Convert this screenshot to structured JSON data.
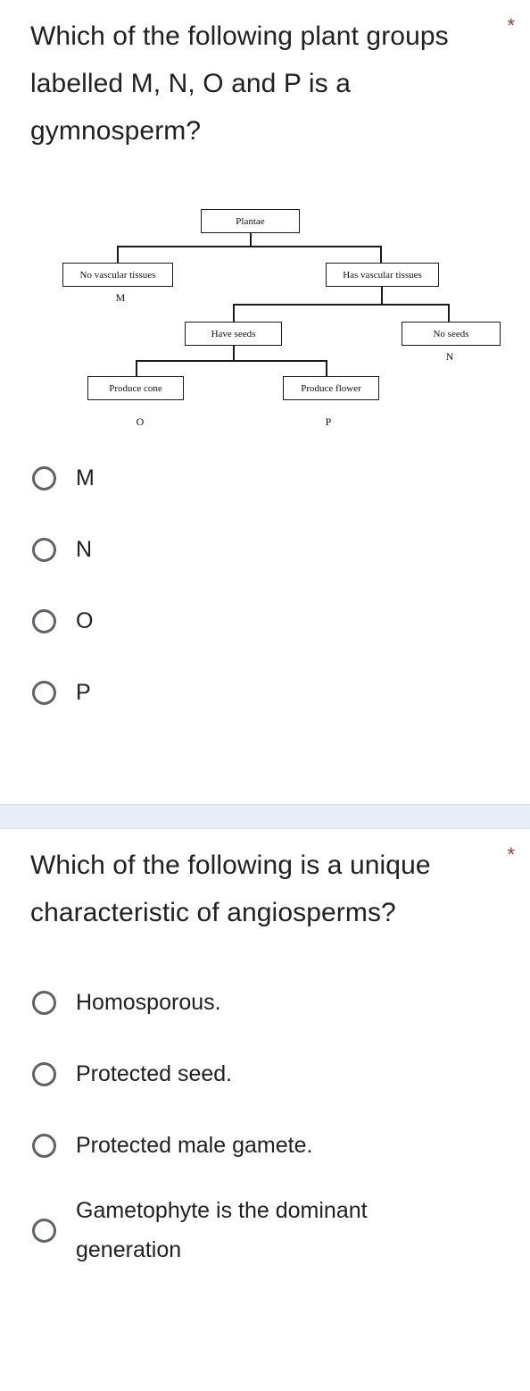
{
  "theme": {
    "page_background": "#ffffff",
    "text_color": "#202124",
    "required_color": "#b3352b",
    "radio_border_color": "#5f6368",
    "divider_band_color": "#e8eef7",
    "divider_border_color": "#dadce0",
    "diagram_line_color": "#1a1a1a"
  },
  "questions": [
    {
      "title": "Which of the following plant groups labelled M, N, O and P is a gymnosperm?",
      "required_marker": "*",
      "options": [
        {
          "label": "M"
        },
        {
          "label": "N"
        },
        {
          "label": "O"
        },
        {
          "label": "P"
        }
      ]
    },
    {
      "title": "Which of the following is a unique characteristic of angiosperms?",
      "required_marker": "*",
      "options": [
        {
          "label": "Homosporous."
        },
        {
          "label": "Protected seed."
        },
        {
          "label": "Protected male gamete."
        },
        {
          "label": "Gametophyte is the dominant generation"
        }
      ]
    }
  ],
  "diagram": {
    "type": "classification-tree",
    "nodes": [
      {
        "id": "root",
        "text": "Plantae"
      },
      {
        "id": "no-vascular",
        "text": "No vascular tissues",
        "tag": "M"
      },
      {
        "id": "has-vascular",
        "text": "Has vascular tissues"
      },
      {
        "id": "have-seeds",
        "text": "Have seeds"
      },
      {
        "id": "no-seeds",
        "text": "No seeds",
        "tag": "N"
      },
      {
        "id": "produce-cone",
        "text": "Produce cone",
        "tag": "O"
      },
      {
        "id": "produce-flower",
        "text": "Produce flower",
        "tag": "P"
      }
    ],
    "edges": [
      {
        "from": "root",
        "to": "no-vascular"
      },
      {
        "from": "root",
        "to": "has-vascular"
      },
      {
        "from": "has-vascular",
        "to": "have-seeds"
      },
      {
        "from": "has-vascular",
        "to": "no-seeds"
      },
      {
        "from": "have-seeds",
        "to": "produce-cone"
      },
      {
        "from": "have-seeds",
        "to": "produce-flower"
      }
    ]
  }
}
